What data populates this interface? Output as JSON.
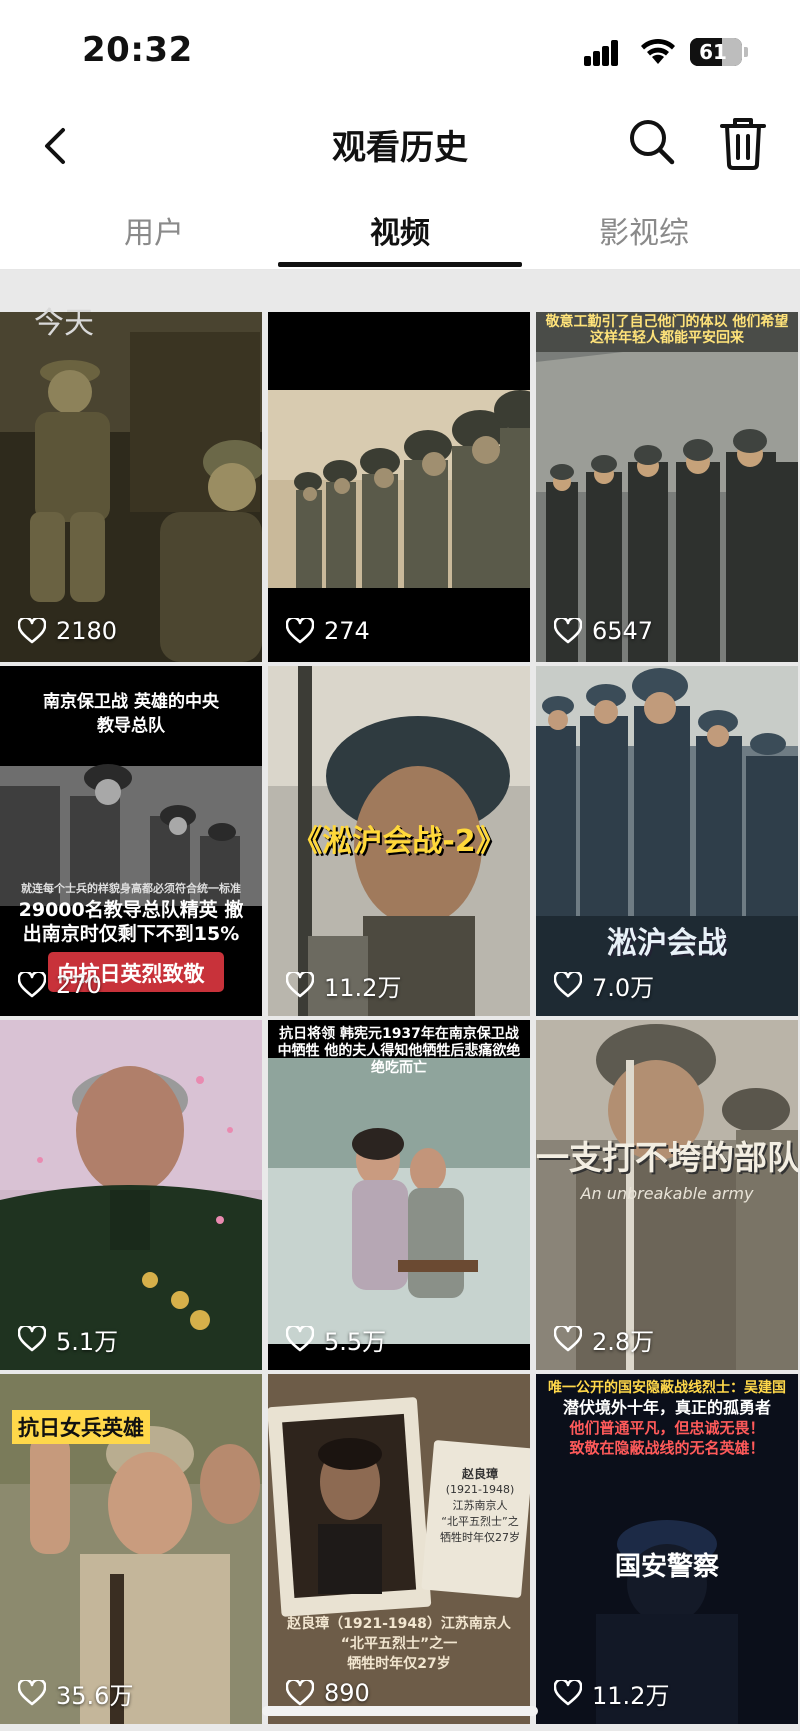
{
  "status_bar": {
    "time": "20:32",
    "battery": "61"
  },
  "nav": {
    "title": "观看历史",
    "back_icon": "chevron-left-icon",
    "search_icon": "search-icon",
    "delete_icon": "trash-icon"
  },
  "tabs": [
    {
      "label": "用户",
      "active": false
    },
    {
      "label": "视频",
      "active": true
    },
    {
      "label": "影视综",
      "active": false
    }
  ],
  "section": {
    "label": "今天"
  },
  "videos": [
    {
      "likes": "2180"
    },
    {
      "likes": "274"
    },
    {
      "likes": "6547",
      "caption": "敬意工勤引了自己他门的体以 他们希望这样年轻人都能平安回来"
    },
    {
      "likes": "270",
      "caption": "南京保卫战 英雄的中央教导总队",
      "caption2": "29000名教导总队精英 撤出南京时仅剩下不到15%",
      "caption3": "向抗日英烈致敬",
      "caption4": "就连每个士兵的样貌身高都必须符合统一标准"
    },
    {
      "likes": "11.2万",
      "caption": "《淞沪会战-2》"
    },
    {
      "likes": "7.0万",
      "caption": "淞沪会战"
    },
    {
      "likes": "5.1万"
    },
    {
      "likes": "5.5万",
      "caption": "抗日将领 韩宪元1937年在南京保卫战中牺牲 他的夫人得知他牺牲后悲痛欲绝 绝吃而亡"
    },
    {
      "likes": "2.8万",
      "caption": "一支打不垮的部队",
      "caption2": "An unbreakable army"
    },
    {
      "likes": "35.6万",
      "caption": "抗日女兵英雄"
    },
    {
      "likes": "890",
      "caption": "赵良璋（1921-1948）江苏南京人",
      "caption2": "“北平五烈士”之一",
      "caption3": "牺牲时年仅27岁",
      "caption4": "赵良璋",
      "caption5": "(1921-1948)",
      "caption6": "江苏南京人",
      "caption7": "“北平五烈士”之",
      "caption8": "牺牲时年仅27岁"
    },
    {
      "likes": "11.2万",
      "caption": "唯一公开的国安隐蔽战线烈士：吴建国",
      "caption2": "潜伏境外十年，真正的孤勇者",
      "caption3": "他们普通平凡，但忠诚无畏！",
      "caption4": "致敬在隐蔽战线的无名英雄！",
      "caption5": "国安警察"
    }
  ],
  "colors": {
    "tab_active": "#111111",
    "tab_inactive": "#8a8a8a",
    "grid_bg": "#e9e9e9"
  }
}
